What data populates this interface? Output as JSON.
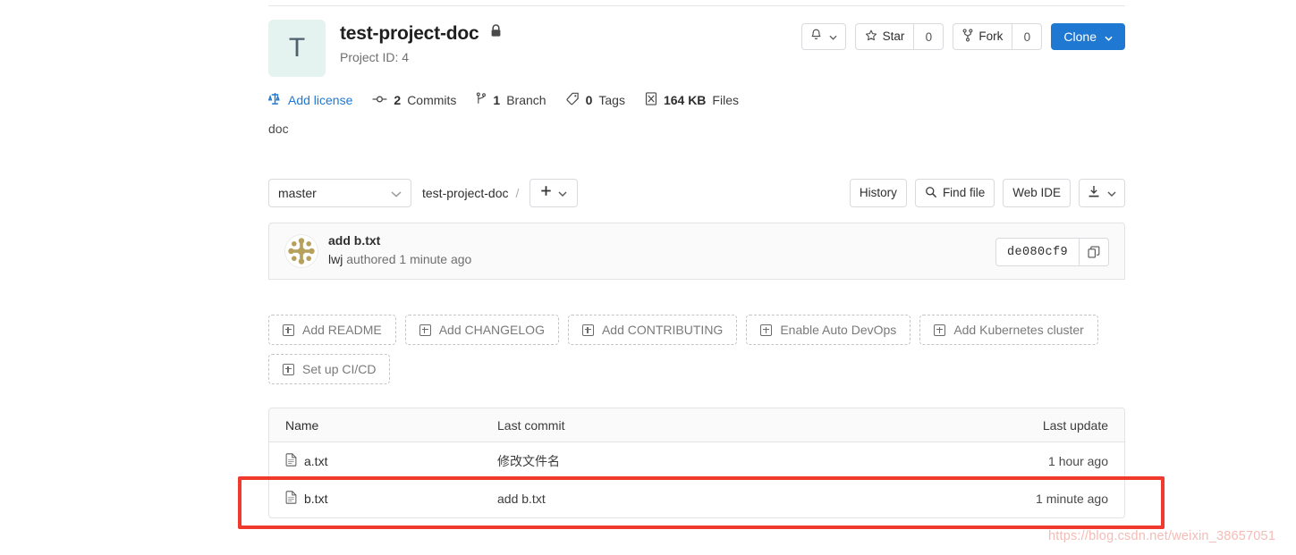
{
  "project": {
    "avatar_letter": "T",
    "name": "test-project-doc",
    "visibility_icon": "lock-icon",
    "project_id_label": "Project ID: 4",
    "description": "doc"
  },
  "header_actions": {
    "notification_icon": "bell-icon",
    "notification_caret": "chevron-down-icon",
    "star_icon": "star-icon",
    "star_label": "Star",
    "star_count": "0",
    "fork_icon": "fork-icon",
    "fork_label": "Fork",
    "fork_count": "0",
    "clone_label": "Clone",
    "clone_caret": "chevron-down-icon",
    "clone_color": "#1f78d1"
  },
  "stats": [
    {
      "icon": "license-icon",
      "value": "",
      "label": "Add license",
      "is_link": true
    },
    {
      "icon": "commit-icon",
      "value": "2",
      "label": "Commits",
      "is_link": false
    },
    {
      "icon": "branch-icon",
      "value": "1",
      "label": "Branch",
      "is_link": false
    },
    {
      "icon": "tag-icon",
      "value": "0",
      "label": "Tags",
      "is_link": false
    },
    {
      "icon": "file-size-icon",
      "value": "164 KB",
      "label": "Files",
      "is_link": false
    }
  ],
  "toolbar": {
    "branch_value": "master",
    "branch_caret": "chevron-down-icon",
    "breadcrumb_root": "test-project-doc",
    "breadcrumb_separator": "/",
    "add_icon": "plus-icon",
    "add_caret": "chevron-down-icon",
    "history_label": "History",
    "find_file_icon": "search-icon",
    "find_file_label": "Find file",
    "web_ide_label": "Web IDE",
    "download_icon": "download-icon",
    "download_caret": "chevron-down-icon"
  },
  "commit": {
    "avatar": "identicon-avatar",
    "title": "add b.txt",
    "author": "lwj",
    "meta": " authored 1 minute ago",
    "sha": "de080cf9",
    "copy_icon": "copy-icon"
  },
  "quick_actions": [
    {
      "icon": "plus-square-icon",
      "label": "Add README"
    },
    {
      "icon": "plus-square-icon",
      "label": "Add CHANGELOG"
    },
    {
      "icon": "plus-square-icon",
      "label": "Add CONTRIBUTING"
    },
    {
      "icon": "plus-square-icon",
      "label": "Enable Auto DevOps"
    },
    {
      "icon": "plus-square-icon",
      "label": "Add Kubernetes cluster"
    }
  ],
  "quick_actions_row2": [
    {
      "icon": "plus-square-icon",
      "label": "Set up CI/CD"
    }
  ],
  "files_table": {
    "columns": {
      "name": "Name",
      "last_commit": "Last commit",
      "last_update": "Last update"
    },
    "rows": [
      {
        "icon": "file-icon",
        "name": "a.txt",
        "last_commit": "修改文件名",
        "last_update": "1 hour ago"
      },
      {
        "icon": "file-icon",
        "name": "b.txt",
        "last_commit": "add b.txt",
        "last_update": "1 minute ago"
      }
    ]
  },
  "annotation": {
    "highlight_color": "#f03a2e"
  },
  "watermark": {
    "text": "https://blog.csdn.net/weixin_38657051"
  }
}
